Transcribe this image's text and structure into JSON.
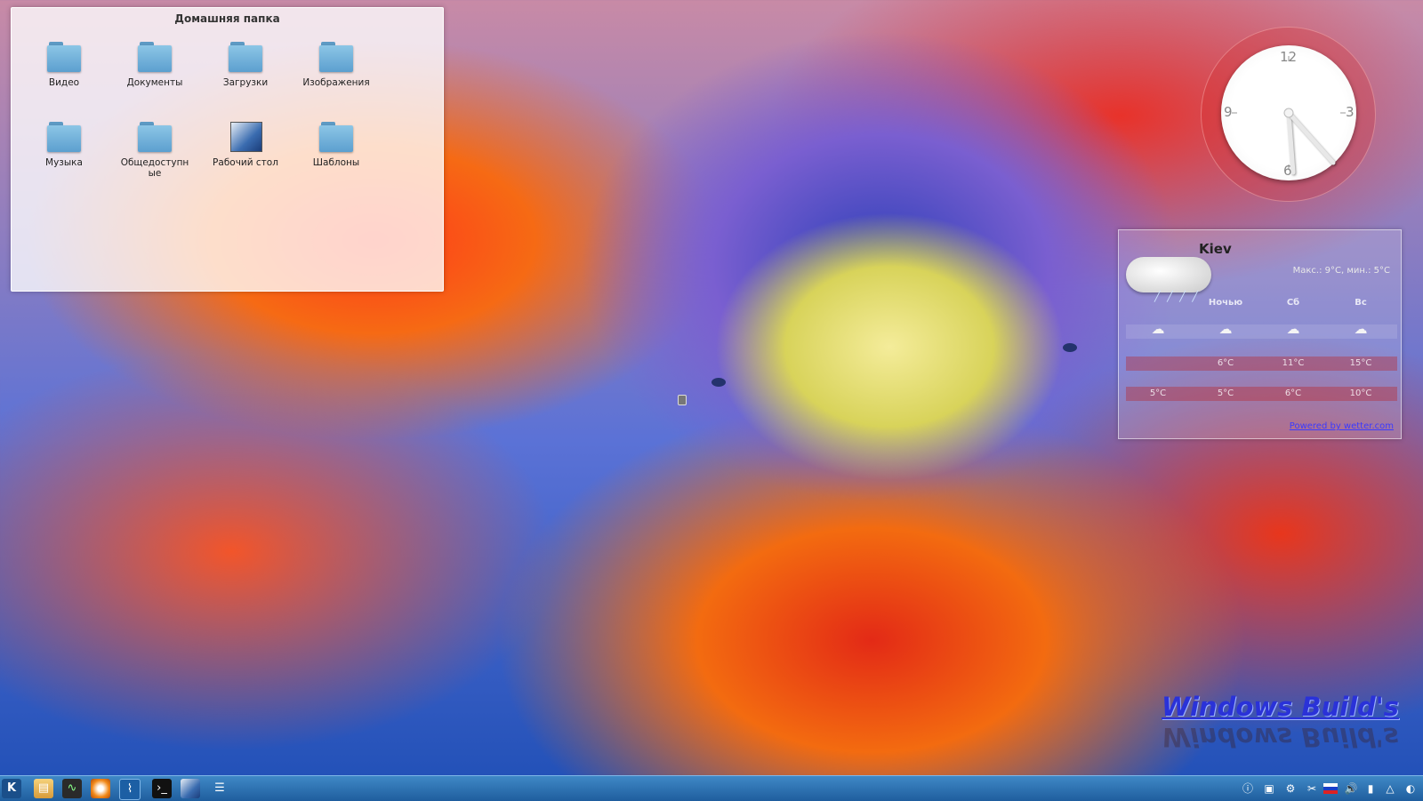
{
  "desktop": {
    "folder_view": {
      "title": "Домашняя папка",
      "items": [
        {
          "label": "Видео",
          "icon": "folder-icon"
        },
        {
          "label": "Документы",
          "icon": "folder-icon"
        },
        {
          "label": "Загрузки",
          "icon": "folder-icon"
        },
        {
          "label": "Изображения",
          "icon": "folder-icon"
        },
        {
          "label": "Музыка",
          "icon": "folder-icon"
        },
        {
          "label": "Общедоступные",
          "label_line1": "Общедоступн",
          "label_line2": "ые",
          "icon": "folder-icon"
        },
        {
          "label": "Рабочий стол",
          "icon": "desktop-folder-icon"
        },
        {
          "label": "Шаблоны",
          "icon": "folder-icon"
        }
      ]
    },
    "clock": {
      "numerals": [
        "12",
        "3",
        "6",
        "9"
      ]
    },
    "weather": {
      "city": "Kiev",
      "range": "Макс.: 9°C, мин.: 5°C",
      "days": [
        "",
        "Ночью",
        "Сб",
        "Вс"
      ],
      "high": [
        "",
        "6°C",
        "11°C",
        "15°C"
      ],
      "low": [
        "5°C",
        "5°C",
        "6°C",
        "10°C"
      ],
      "powered": "Powered by wetter.com"
    },
    "watermark": "Windows Build's",
    "taskbar": {
      "colors": {
        "bar": "#2a6fb0",
        "accent": "#7fb6e8"
      }
    }
  }
}
